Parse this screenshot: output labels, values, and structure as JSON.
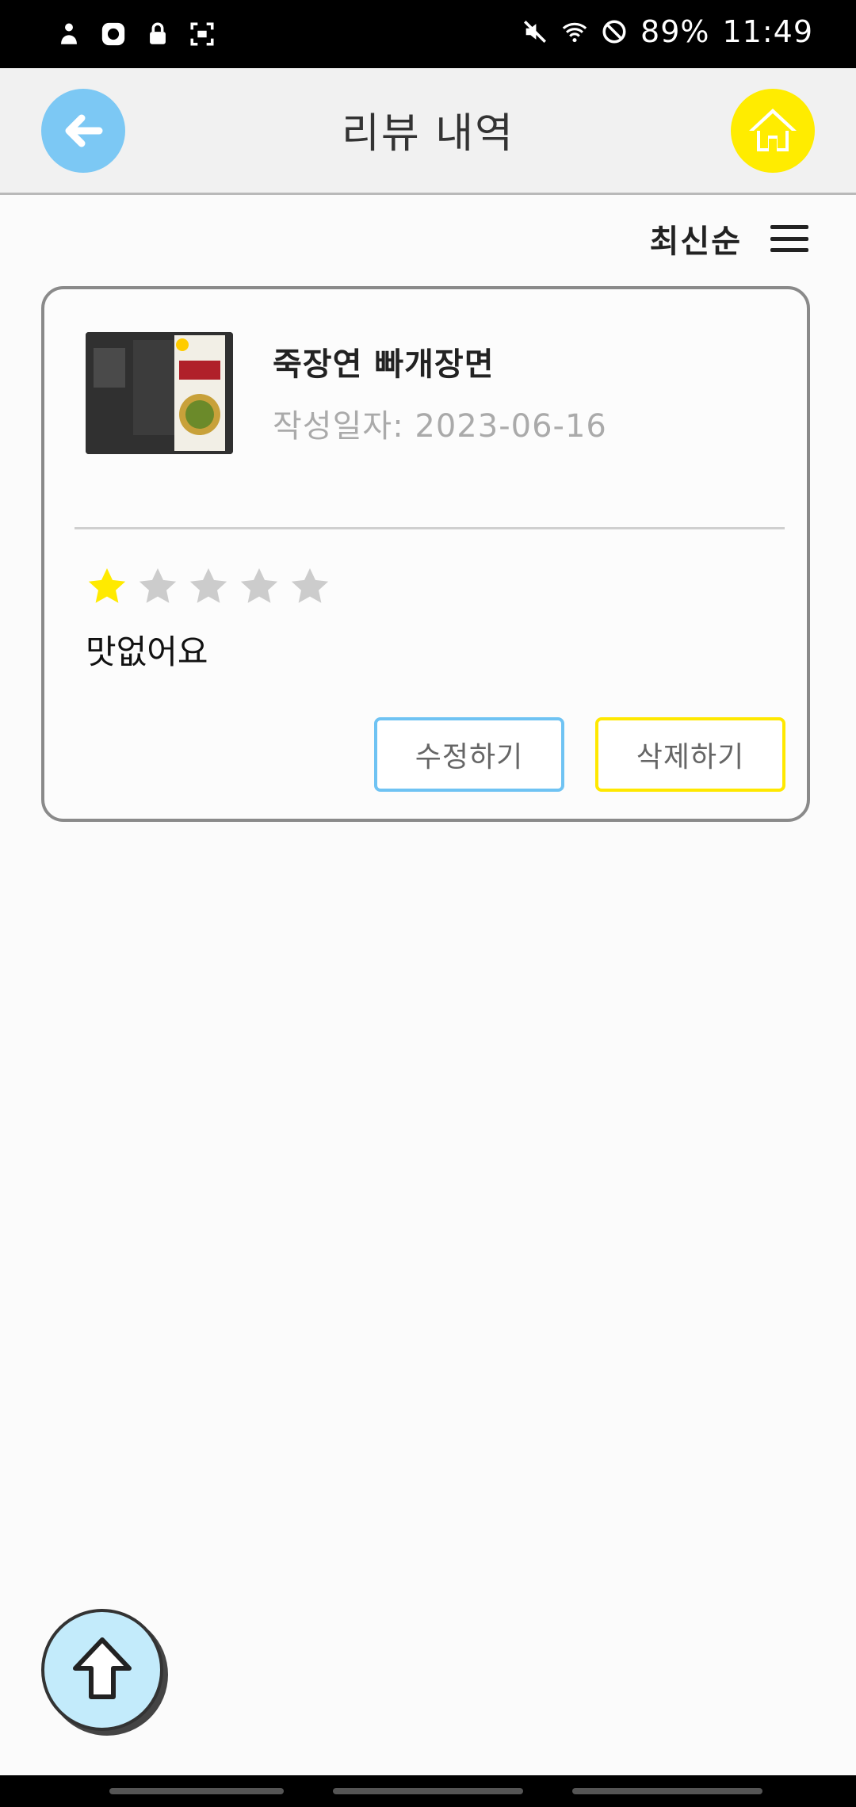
{
  "status_bar": {
    "battery": "89%",
    "time": "11:49",
    "icons_left": [
      "person-icon",
      "app-icon",
      "lock-icon",
      "screenshot-icon"
    ],
    "icons_right": [
      "mute-icon",
      "wifi-icon",
      "dnd-icon"
    ]
  },
  "header": {
    "title": "리뷰 내역",
    "back_icon": "arrow-left-icon",
    "home_icon": "home-icon",
    "back_color": "#7cc8f4",
    "home_color": "#ffec00"
  },
  "sort": {
    "label": "최신순",
    "icon": "menu-icon"
  },
  "review": {
    "product_name": "죽장연 빠개장면",
    "date": "작성일자: 2023-06-16",
    "rating": 1,
    "max_rating": 5,
    "text": "맛없어요",
    "edit_label": "수정하기",
    "delete_label": "삭제하기"
  },
  "scroll_top": {
    "icon": "arrow-up-icon"
  }
}
